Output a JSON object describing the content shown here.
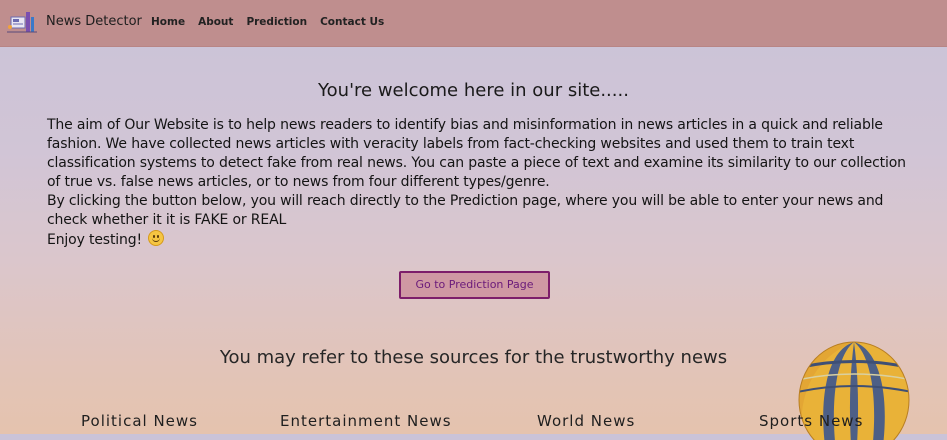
{
  "navbar": {
    "brand": "News Detector",
    "logo_icon": "news-detector-logo-icon",
    "links": [
      "Home",
      "About",
      "Prediction",
      "Contact Us"
    ]
  },
  "main": {
    "welcome": "You're welcome here in our site.....",
    "intro_paragraphs": [
      "The aim of Our Website is to help news readers to identify bias and misinformation in news articles in a quick and reliable fashion. We have collected news articles with veracity labels from fact-checking websites and used them to train text classification systems to detect fake from real news. You can paste a piece of text and examine its similarity to our collection of true vs. false news articles, or to news from four different types/genre.",
      "By clicking the button below, you will reach directly to the Prediction page, where you will be able to enter your news and check whether it it is FAKE or REAL",
      "Enjoy testing!"
    ],
    "smiley_icon": "smiley-emoji-icon",
    "prediction_button": "Go to Prediction Page",
    "sources_heading": "You may refer to these sources for the trustworthy news",
    "categories": [
      "Political News",
      "Entertainment News",
      "World News",
      "Sports News"
    ]
  },
  "colors": {
    "navbar": "#bf8e8e",
    "button_border": "#7d1d6a",
    "button_text": "#6a1a7a"
  }
}
